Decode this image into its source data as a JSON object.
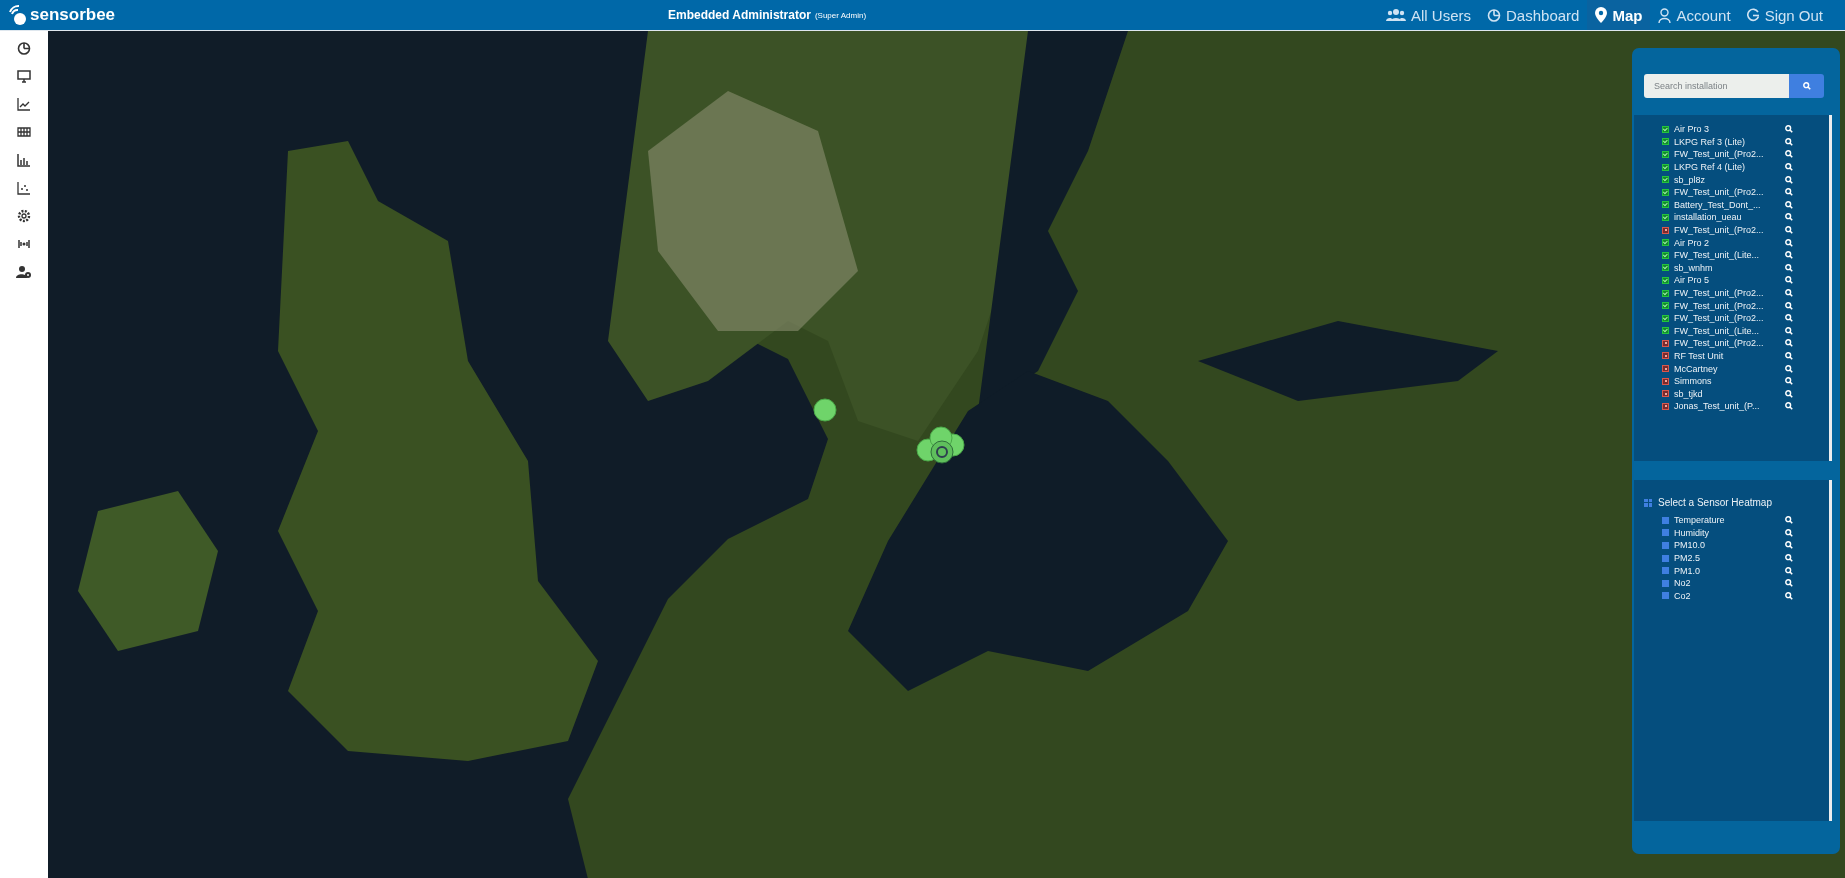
{
  "header": {
    "logo": "sensorbee",
    "title": "Embedded Administrator",
    "role": "(Super Admin)",
    "nav": [
      {
        "kind": "users",
        "label": "All Users",
        "selected": false
      },
      {
        "kind": "dashboard",
        "label": "Dashboard",
        "selected": false
      },
      {
        "kind": "map",
        "label": "Map",
        "selected": true
      },
      {
        "kind": "account",
        "label": "Account",
        "selected": false
      },
      {
        "kind": "signout",
        "label": "Sign Out",
        "selected": false
      }
    ]
  },
  "sidebar": {
    "items": [
      {
        "kind": "pie"
      },
      {
        "kind": "monitor"
      },
      {
        "kind": "line"
      },
      {
        "kind": "grid"
      },
      {
        "kind": "bars"
      },
      {
        "kind": "scatter"
      },
      {
        "kind": "gear"
      },
      {
        "kind": "signal"
      },
      {
        "kind": "usergear"
      }
    ]
  },
  "panel": {
    "search": {
      "placeholder": "Search installation"
    },
    "installations": [
      {
        "name": "Air Pro 3",
        "active": true
      },
      {
        "name": "LKPG Ref 3 (Lite)",
        "active": true
      },
      {
        "name": "FW_Test_unit_(Pro2...",
        "active": true
      },
      {
        "name": "LKPG Ref 4 (Lite)",
        "active": true
      },
      {
        "name": "sb_pl8z",
        "active": true
      },
      {
        "name": "FW_Test_unit_(Pro2...",
        "active": true
      },
      {
        "name": "Battery_Test_Dont_...",
        "active": true
      },
      {
        "name": "installation_ueau",
        "active": true
      },
      {
        "name": "FW_Test_unit_(Pro2...",
        "active": false
      },
      {
        "name": "Air Pro 2",
        "active": true
      },
      {
        "name": "FW_Test_unit_(Lite...",
        "active": true
      },
      {
        "name": "sb_wnhm",
        "active": true
      },
      {
        "name": "Air Pro 5",
        "active": true
      },
      {
        "name": "FW_Test_unit_(Pro2...",
        "active": true
      },
      {
        "name": "FW_Test_unit_(Pro2...",
        "active": true
      },
      {
        "name": "FW_Test_unit_(Pro2...",
        "active": true
      },
      {
        "name": "FW_Test_unit_(Lite...",
        "active": true
      },
      {
        "name": "FW_Test_unit_(Pro2...",
        "active": false
      },
      {
        "name": "RF Test Unit",
        "active": false
      },
      {
        "name": "McCartney",
        "active": false
      },
      {
        "name": "Simmons",
        "active": false
      },
      {
        "name": "sb_tjkd",
        "active": false
      },
      {
        "name": "Jonas_Test_unit_(P...",
        "active": false
      }
    ],
    "heatmap": {
      "title": "Select a Sensor Heatmap",
      "sensors": [
        {
          "name": "Temperature"
        },
        {
          "name": "Humidity"
        },
        {
          "name": "PM10.0"
        },
        {
          "name": "PM2.5"
        },
        {
          "name": "PM1.0"
        },
        {
          "name": "No2"
        },
        {
          "name": "Co2"
        }
      ]
    }
  }
}
